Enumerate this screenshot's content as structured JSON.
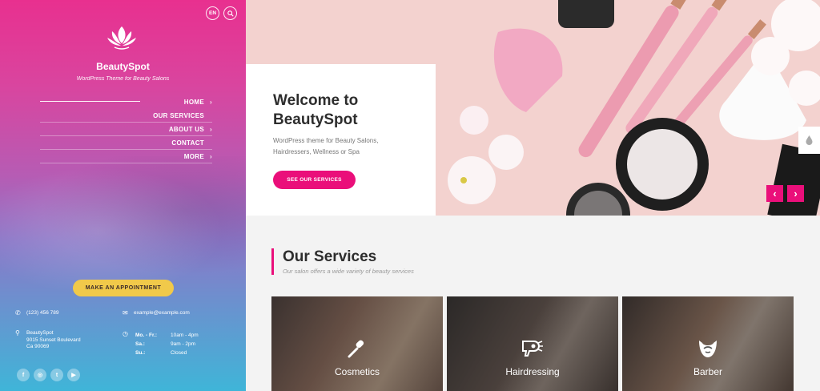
{
  "colors": {
    "accent": "#ea0f7a",
    "appointment": "#f1c94a",
    "text_dark": "#2d2d2d"
  },
  "sidebar": {
    "lang_label": "EN",
    "search_icon": "search-icon",
    "logo_icon": "lotus-icon",
    "title": "BeautySpot",
    "subtitle": "WordPress Theme for Beauty Salons",
    "nav": [
      {
        "label": "HOME",
        "active": true
      },
      {
        "label": "OUR SERVICES",
        "active": false
      },
      {
        "label": "ABOUT US",
        "active": false
      },
      {
        "label": "CONTACT",
        "active": false
      },
      {
        "label": "MORE",
        "active": false
      }
    ],
    "appointment_label": "MAKE AN APPOINTMENT",
    "phone": "(123) 456 789",
    "email": "example@example.com",
    "address": {
      "name": "BeautySpot",
      "street": "9015 Sunset Boulevard",
      "city": "Ca 90069"
    },
    "hours": [
      {
        "day": "Mo. - Fr.:",
        "time": "10am - 4pm"
      },
      {
        "day": "Sa.:",
        "time": "9am - 2pm"
      },
      {
        "day": "Su.:",
        "time": "Closed"
      }
    ],
    "socials": [
      {
        "label": "f",
        "icon": "facebook-icon"
      },
      {
        "label": "◎",
        "icon": "instagram-icon"
      },
      {
        "label": "t",
        "icon": "twitter-icon"
      },
      {
        "label": "▶",
        "icon": "youtube-icon"
      }
    ]
  },
  "hero": {
    "title": "Welcome to BeautySpot",
    "description": "WordPress theme for Beauty Salons, Hairdressers, Wellness or Spa",
    "button_label": "SEE OUR SERVICES",
    "prev_label": "‹",
    "next_label": "›"
  },
  "services": {
    "title": "Our Services",
    "subtitle": "Our salon offers a wide variety of beauty services",
    "cards": [
      {
        "name": "Cosmetics",
        "icon": "makeup-brush-icon"
      },
      {
        "name": "Hairdressing",
        "icon": "hair-dryer-icon"
      },
      {
        "name": "Barber",
        "icon": "beard-icon"
      }
    ]
  }
}
